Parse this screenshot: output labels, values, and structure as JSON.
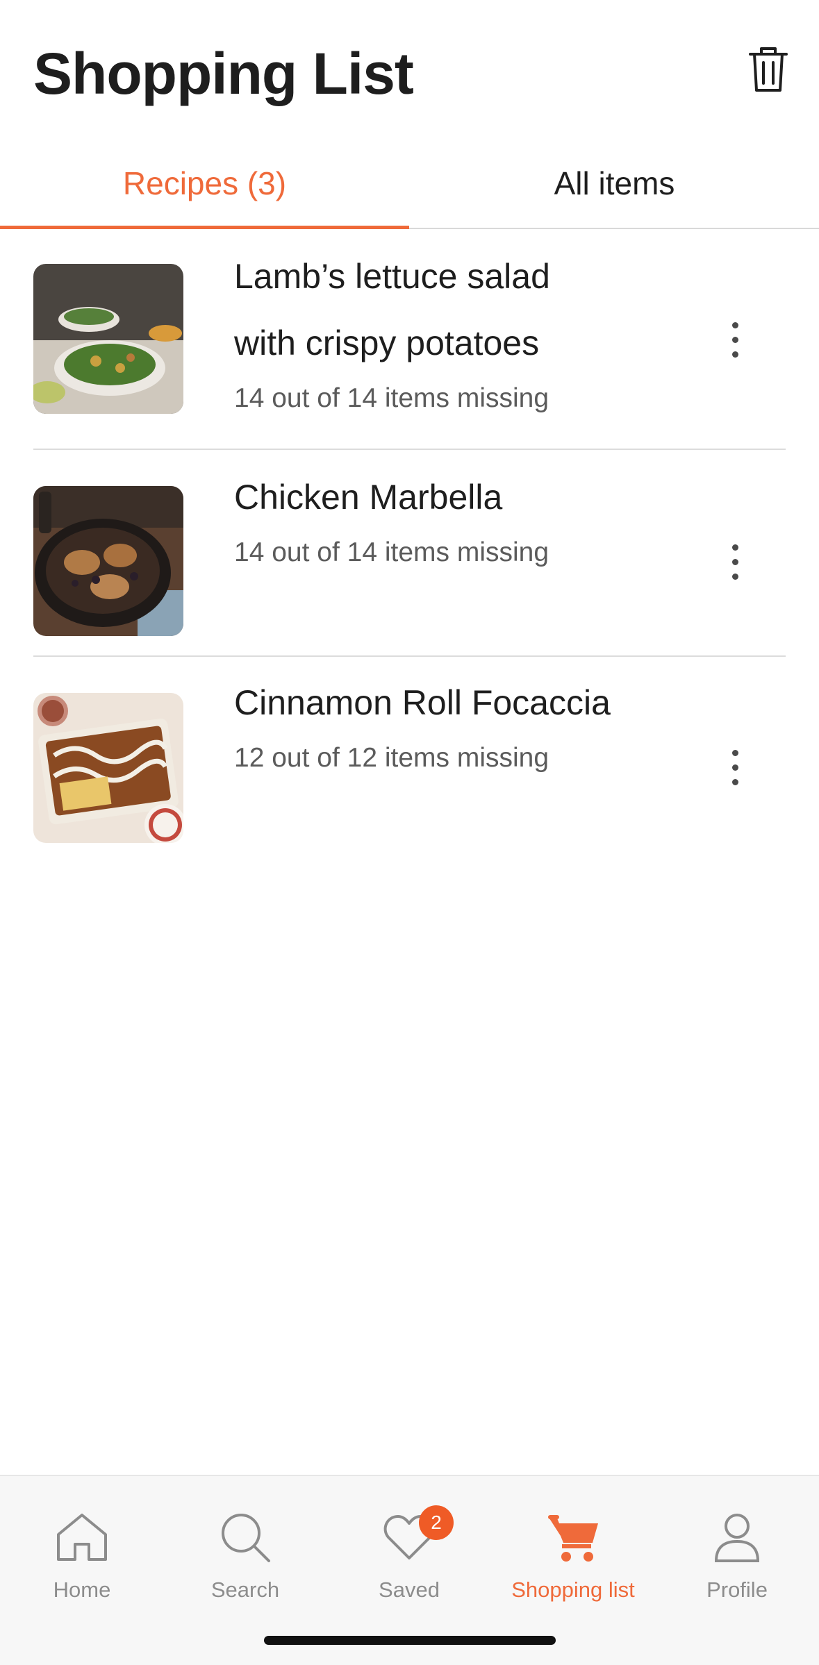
{
  "header": {
    "title": "Shopping List",
    "clear_icon": "trash-icon"
  },
  "tabs": [
    {
      "label": "Recipes (3)",
      "active": true
    },
    {
      "label": "All items",
      "active": false
    }
  ],
  "recipes": [
    {
      "title_line1": "Lamb’s lettuce salad",
      "title_line2": "with crispy potatoes",
      "status": "14 out of 14 items missing"
    },
    {
      "title_line1": "Chicken Marbella",
      "status": "14 out of 14 items missing"
    },
    {
      "title_line1": "Cinnamon Roll Focaccia",
      "status": "12 out of 12 items missing"
    }
  ],
  "bottom_nav": {
    "items": [
      {
        "label": "Home",
        "icon": "home-icon"
      },
      {
        "label": "Search",
        "icon": "search-icon"
      },
      {
        "label": "Saved",
        "icon": "heart-icon",
        "badge": "2"
      },
      {
        "label": "Shopping list",
        "icon": "cart-icon",
        "active": true
      },
      {
        "label": "Profile",
        "icon": "profile-icon"
      }
    ]
  },
  "colors": {
    "accent": "#ef6a3a",
    "text": "#1e1e1e",
    "muted": "#8c8c8c"
  }
}
